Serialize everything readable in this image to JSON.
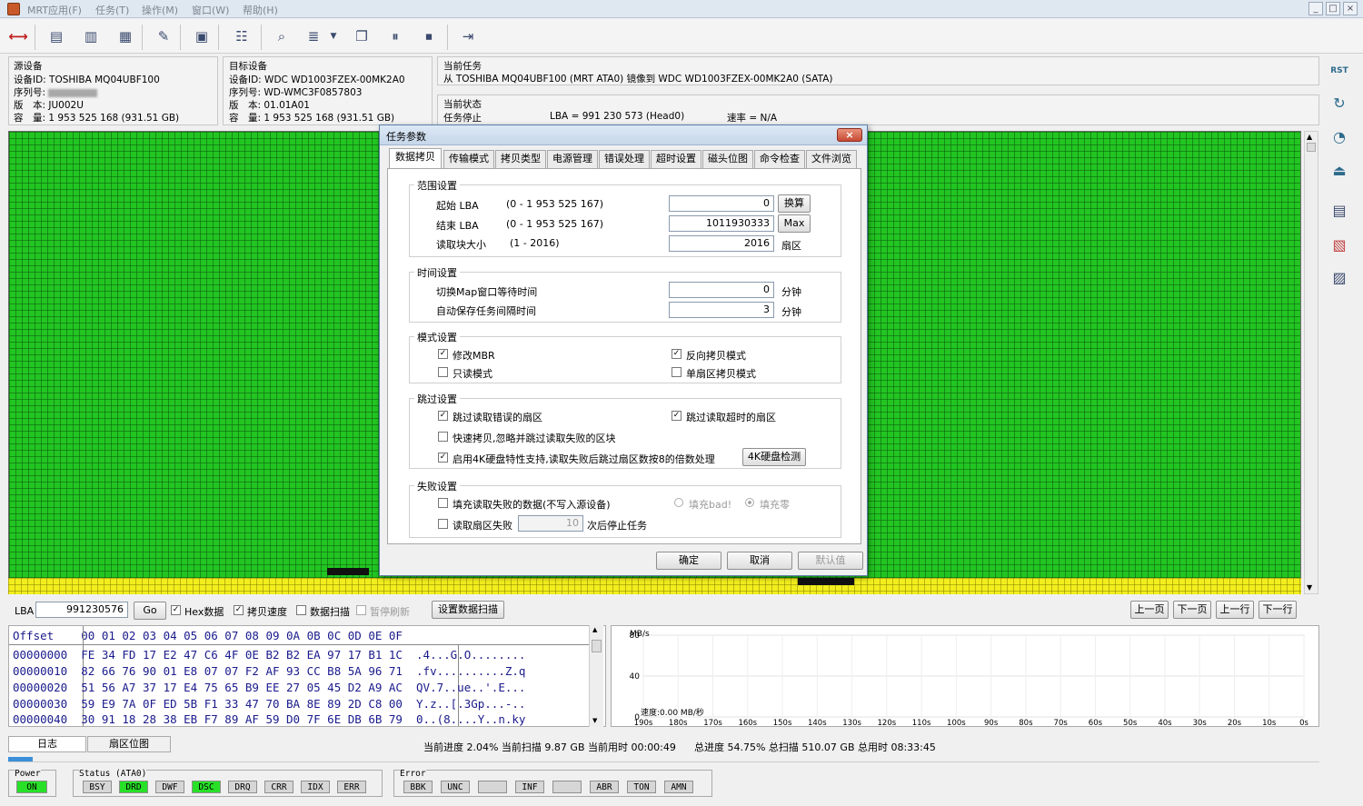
{
  "menu": [
    "MRT应用(F)",
    "任务(T)",
    "操作(M)",
    "窗口(W)",
    "帮助(H)"
  ],
  "window_controls": [
    "_",
    "□",
    "×"
  ],
  "source": {
    "title": "源设备",
    "device_id": "设备ID: TOSHIBA MQ04UBF100",
    "serial_label": "序列号:",
    "version": "版　本: JU002U",
    "capacity": "容　量: 1 953 525 168 (931.51 GB)"
  },
  "target": {
    "title": "目标设备",
    "device_id": "设备ID: WDC WD1003FZEX-00MK2A0",
    "serial": "序列号: WD-WMC3F0857803",
    "version": "版　本: 01.01A01",
    "capacity": "容　量: 1 953 525 168 (931.51 GB)"
  },
  "task": {
    "title": "当前任务",
    "text": "从 TOSHIBA MQ04UBF100 (MRT ATA0) 镜像到 WDC WD1003FZEX-00MK2A0 (SATA)",
    "status_title": "当前状态",
    "status": "任务停止",
    "lba": "LBA = 991 230 573 (Head0)",
    "speed": "速率 = N/A"
  },
  "sidebar": {
    "rst": "RST"
  },
  "dialog": {
    "title": "任务参数",
    "close": "×",
    "tabs": [
      "数据拷贝",
      "传输模式",
      "拷贝类型",
      "电源管理",
      "错误处理",
      "超时设置",
      "磁头位图",
      "命令检查",
      "文件浏览"
    ],
    "range": {
      "title": "范围设置",
      "start_label": "起始 LBA",
      "start_range": "(0 - 1 953 525 167)",
      "start_value": "0",
      "convert_btn": "换算",
      "end_label": "结束 LBA",
      "end_range": "(0 - 1 953 525 167)",
      "end_value": "1011930333",
      "max_btn": "Max",
      "block_label": "读取块大小",
      "block_range": "(1 - 2016)",
      "block_value": "2016",
      "block_unit": "扇区"
    },
    "time": {
      "title": "时间设置",
      "map_label": "切换Map窗口等待时间",
      "map_value": "0",
      "map_unit": "分钟",
      "save_label": "自动保存任务间隔时间",
      "save_value": "3",
      "save_unit": "分钟"
    },
    "mode": {
      "title": "模式设置",
      "mbr": "修改MBR",
      "reverse": "反向拷贝模式",
      "readonly": "只读模式",
      "single": "单扇区拷贝模式"
    },
    "skip": {
      "title": "跳过设置",
      "skip_err": "跳过读取错误的扇区",
      "skip_timeout": "跳过读取超时的扇区",
      "fast": "快速拷贝,忽略并跳过读取失败的区块",
      "k4": "启用4K硬盘特性支持,读取失败后跳过扇区数按8的倍数处理",
      "k4_btn": "4K硬盘检测"
    },
    "fail": {
      "title": "失败设置",
      "fill": "填充读取失败的数据(不写入源设备)",
      "fill_bad": "填充bad!",
      "fill_zero": "填充零",
      "read_fail": "读取扇区失败",
      "read_fail_value": "10",
      "read_fail_suffix": "次后停止任务"
    },
    "ok": "确定",
    "cancel": "取消",
    "default": "默认值"
  },
  "lba_bar": {
    "label": "LBA",
    "value": "991230576",
    "go": "Go",
    "hex": "Hex数据",
    "speed": "拷贝速度",
    "scan": "数据扫描",
    "pause": "暂停刷新",
    "set_scan": "设置数据扫描",
    "prev_page": "上一页",
    "next_page": "下一页",
    "prev_line": "上一行",
    "next_line": "下一行"
  },
  "hex": {
    "header": "Offset    00 01 02 03 04 05 06 07 08 09 0A 0B 0C 0D 0E 0F",
    "rows": [
      "00000000  FE 34 FD 17 E2 47 C6 4F 0E B2 B2 EA 97 17 B1 1C  .4...G.O........",
      "00000010  82 66 76 90 01 E8 07 07 F2 AF 93 CC B8 5A 96 71  .fv..........Z.q",
      "00000020  51 56 A7 37 17 E4 75 65 B9 EE 27 05 45 D2 A9 AC  QV.7..ue..'.E...",
      "00000030  59 E9 7A 0F ED 5B F1 33 47 70 BA 8E 89 2D C8 00  Y.z..[.3Gp...-..",
      "00000040  30 91 18 28 38 EB F7 89 AF 59 D0 7F 6E DB 6B 79  0..(8....Y..n.ky"
    ]
  },
  "chart_data": {
    "type": "line",
    "ylabel": "MB/s",
    "ylim": [
      0,
      80
    ],
    "y_ticks": [
      "80",
      "40",
      "0"
    ],
    "x_ticks": [
      "190s",
      "180s",
      "170s",
      "160s",
      "150s",
      "140s",
      "130s",
      "120s",
      "110s",
      "100s",
      "90s",
      "80s",
      "70s",
      "60s",
      "50s",
      "40s",
      "30s",
      "20s",
      "10s",
      "0s"
    ],
    "annotation": "速度:0.00 MB/秒",
    "series": [
      {
        "values": []
      }
    ]
  },
  "tabs_bottom": [
    "日志",
    "扇区位图"
  ],
  "progress": {
    "current": "当前进度 2.04% 当前扫描 9.87 GB 当前用时 00:00:49",
    "total": "总进度 54.75% 总扫描 510.07 GB 总用时 08:33:45"
  },
  "status": {
    "power_label": "Power",
    "power": "ON",
    "status_label": "Status (ATA0)",
    "status_inds": [
      "BSY",
      "DRD",
      "DWF",
      "DSC",
      "DRQ",
      "CRR",
      "IDX",
      "ERR"
    ],
    "error_label": "Error",
    "error_inds": [
      "BBK",
      "UNC",
      "",
      "INF",
      "",
      "ABR",
      "TON",
      "AMN"
    ]
  },
  "colors": {
    "map_green": "#22c522",
    "map_yellow": "#f2ee1e",
    "indicator_on": "#28e028"
  }
}
